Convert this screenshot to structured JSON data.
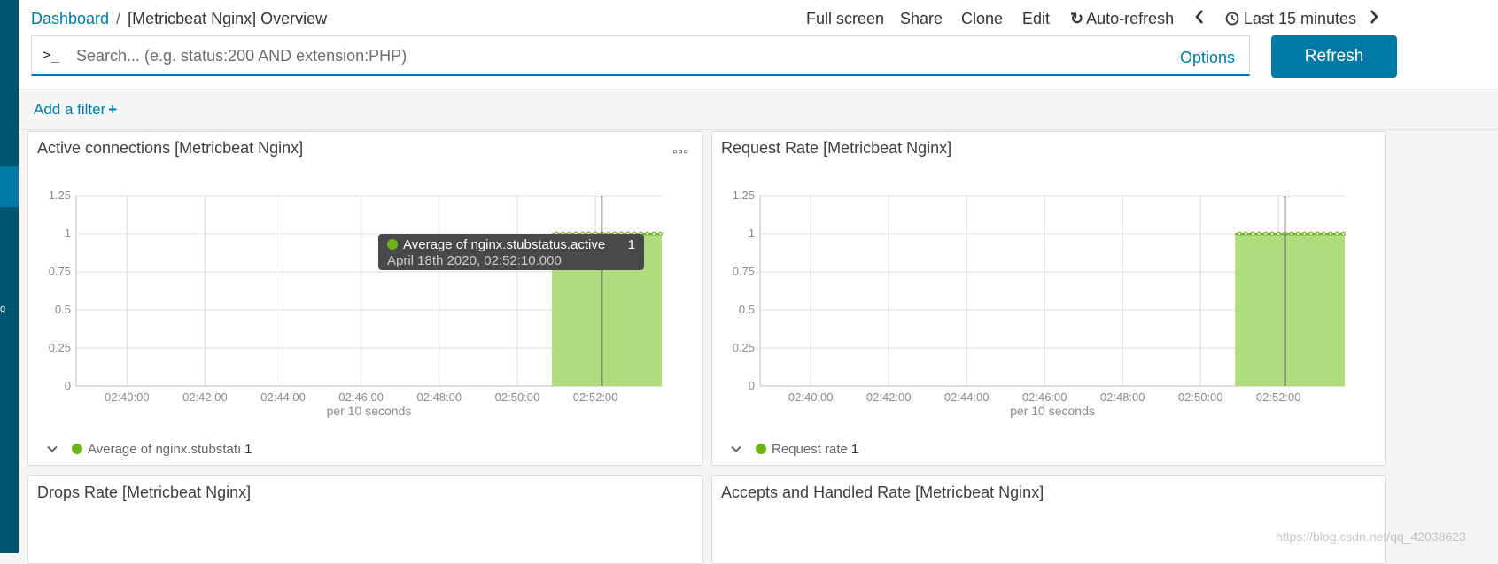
{
  "breadcrumb": {
    "root": "Dashboard",
    "separator": "/",
    "current": "[Metricbeat Nginx] Overview"
  },
  "top_menu": {
    "full_screen": "Full screen",
    "share": "Share",
    "clone": "Clone",
    "edit": "Edit",
    "auto_refresh": "Auto-refresh",
    "time_range": "Last 15 minutes"
  },
  "search": {
    "prompt": ">_",
    "placeholder": "Search... (e.g. status:200 AND extension:PHP)",
    "options_label": "Options",
    "refresh_label": "Refresh"
  },
  "filter_bar": {
    "add_filter_label": "Add a filter",
    "plus": "+"
  },
  "colors": {
    "accent": "#0079a5",
    "sidenav": "#005571",
    "series": "#6eb416",
    "bar_fill": "#b0dc7d"
  },
  "icons": {
    "auto_refresh": "refresh-icon",
    "clock": "clock-icon",
    "prev": "chevron-left-icon",
    "next": "chevron-right-icon",
    "panel_menu": "ellipsis-icon",
    "legend_toggle": "chevron-down-icon"
  },
  "panels": [
    {
      "title": "Active connections [Metricbeat Nginx]",
      "menu_glyph": "▫▫▫",
      "legend": {
        "toggle": "⌄",
        "label": "Average of nginx.stubstatı",
        "value": "1"
      },
      "tooltip": {
        "series": "Average of nginx.stubstatus.active",
        "value": "1",
        "time": "April 18th 2020, 02:52:10.000"
      }
    },
    {
      "title": "Request Rate [Metricbeat Nginx]",
      "legend": {
        "toggle": "⌄",
        "label": "Request rate",
        "value": "1"
      }
    },
    {
      "title": "Drops Rate [Metricbeat Nginx]"
    },
    {
      "title": "Accepts and Handled Rate [Metricbeat Nginx]"
    }
  ],
  "chart_data": [
    {
      "type": "area",
      "title": "Active connections [Metricbeat Nginx]",
      "xlabel": "per 10 seconds",
      "ylabel": "",
      "x_ticks": [
        "02:40:00",
        "02:42:00",
        "02:44:00",
        "02:46:00",
        "02:48:00",
        "02:50:00",
        "02:52:00"
      ],
      "y_ticks": [
        "0",
        "0.25",
        "0.5",
        "0.75",
        "1",
        "1.25"
      ],
      "ylim": [
        0,
        1.25
      ],
      "xlim": [
        "02:38:42",
        "02:53:42"
      ],
      "grid": true,
      "cursor_time": "02:52:10",
      "series": [
        {
          "name": "Average of nginx.stubstatus.active",
          "color": "#6eb416",
          "x": [
            "02:51:00",
            "02:51:10",
            "02:51:20",
            "02:51:30",
            "02:51:40",
            "02:51:50",
            "02:52:00",
            "02:52:10",
            "02:52:20",
            "02:52:30",
            "02:52:40",
            "02:52:50",
            "02:53:00",
            "02:53:10",
            "02:53:20",
            "02:53:30",
            "02:53:40"
          ],
          "values": [
            1,
            1,
            1,
            1,
            1,
            1,
            1,
            1,
            1,
            1,
            1,
            1,
            1,
            1,
            1,
            1,
            1
          ]
        }
      ]
    },
    {
      "type": "area",
      "title": "Request Rate [Metricbeat Nginx]",
      "xlabel": "per 10 seconds",
      "ylabel": "",
      "x_ticks": [
        "02:40:00",
        "02:42:00",
        "02:44:00",
        "02:46:00",
        "02:48:00",
        "02:50:00",
        "02:52:00"
      ],
      "y_ticks": [
        "0",
        "0.25",
        "0.5",
        "0.75",
        "1",
        "1.25"
      ],
      "ylim": [
        0,
        1.25
      ],
      "xlim": [
        "02:38:42",
        "02:53:42"
      ],
      "grid": true,
      "cursor_time": "02:52:10",
      "series": [
        {
          "name": "Request rate",
          "color": "#6eb416",
          "x": [
            "02:51:00",
            "02:51:10",
            "02:51:20",
            "02:51:30",
            "02:51:40",
            "02:51:50",
            "02:52:00",
            "02:52:10",
            "02:52:20",
            "02:52:30",
            "02:52:40",
            "02:52:50",
            "02:53:00",
            "02:53:10",
            "02:53:20",
            "02:53:30",
            "02:53:40"
          ],
          "values": [
            1,
            1,
            1,
            1,
            1,
            1,
            1,
            1,
            1,
            1,
            1,
            1,
            1,
            1,
            1,
            1,
            1
          ]
        }
      ]
    }
  ],
  "watermark": "https://blog.csdn.net/qq_42038623"
}
